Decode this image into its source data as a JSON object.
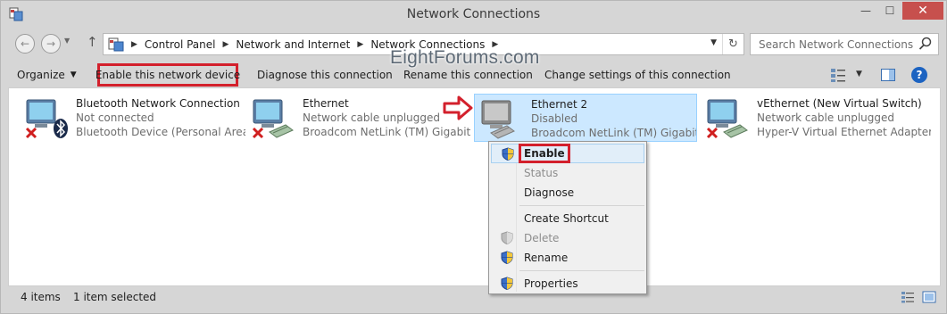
{
  "window": {
    "title": "Network Connections",
    "close_label": "✕",
    "min_label": "—",
    "max_label": "☐"
  },
  "nav": {
    "breadcrumbs": [
      "Control Panel",
      "Network and Internet",
      "Network Connections"
    ],
    "search_placeholder": "Search Network Connections"
  },
  "toolbar": {
    "organize": "Organize",
    "enable": "Enable this network device",
    "diagnose": "Diagnose this connection",
    "rename": "Rename this connection",
    "change": "Change settings of this connection"
  },
  "watermark": "EightForums.com",
  "connections": [
    {
      "name": "Bluetooth Network Connection",
      "status": "Not connected",
      "device": "Bluetooth Device (Personal Area ...",
      "icon": "bluetooth-network-icon",
      "selected": false
    },
    {
      "name": "Ethernet",
      "status": "Network cable unplugged",
      "device": "Broadcom NetLink (TM) Gigabit E...",
      "icon": "ethernet-network-icon",
      "selected": false
    },
    {
      "name": "Ethernet 2",
      "status": "Disabled",
      "device": "Broadcom NetLink (TM) Gigabit E...",
      "icon": "disabled-network-icon",
      "selected": true
    },
    {
      "name": "vEthernet (New Virtual Switch)",
      "status": "Network cable unplugged",
      "device": "Hyper-V Virtual Ethernet Adapter ...",
      "icon": "ethernet-network-icon",
      "selected": false
    }
  ],
  "context_menu": {
    "enable": "Enable",
    "status": "Status",
    "diagnose": "Diagnose",
    "create_shortcut": "Create Shortcut",
    "delete": "Delete",
    "rename": "Rename",
    "properties": "Properties"
  },
  "status": {
    "count": "4 items",
    "selected": "1 item selected"
  },
  "colors": {
    "highlight": "#d3202c",
    "selection": "#cce8ff",
    "close_button": "#c7504d"
  }
}
